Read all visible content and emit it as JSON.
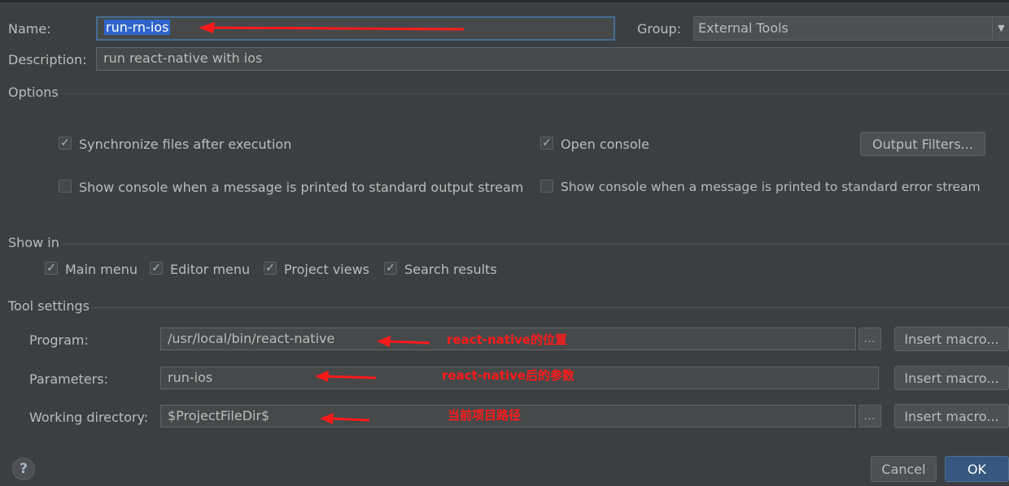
{
  "header": {
    "name_label": "Name:",
    "name_value": "run-rn-ios",
    "group_label": "Group:",
    "group_value": "External Tools",
    "description_label": "Description:",
    "description_value": "run react-native with ios"
  },
  "options": {
    "title": "Options",
    "sync_files": {
      "label": "Synchronize files after execution",
      "checked": true
    },
    "open_console": {
      "label": "Open console",
      "checked": true
    },
    "output_filters_label": "Output Filters...",
    "show_stdout": {
      "label": "Show console when a message is printed to standard output stream",
      "checked": false
    },
    "show_stderr": {
      "label": "Show console when a message is printed to standard error stream",
      "checked": false
    }
  },
  "show_in": {
    "title": "Show in",
    "items": [
      {
        "label": "Main menu",
        "checked": true
      },
      {
        "label": "Editor menu",
        "checked": true
      },
      {
        "label": "Project views",
        "checked": true
      },
      {
        "label": "Search results",
        "checked": true
      }
    ]
  },
  "tool_settings": {
    "title": "Tool settings",
    "program_label": "Program:",
    "program_value": "/usr/local/bin/react-native",
    "parameters_label": "Parameters:",
    "parameters_value": "run-ios",
    "workdir_label": "Working directory:",
    "workdir_value": "$ProjectFileDir$",
    "insert_macro_label": "Insert macro...",
    "browse_label": "..."
  },
  "annotations": {
    "program_note": "react-native的位置",
    "parameters_note": "react-native后的参数",
    "workdir_note": "当前项目路径"
  },
  "footer": {
    "help_label": "?",
    "cancel_label": "Cancel",
    "ok_label": "OK"
  },
  "colors": {
    "background": "#3c3f41",
    "field_bg": "#45494a",
    "focus_border": "#466d94",
    "selection": "#2f65ca",
    "annotation_red": "#ff1a1a",
    "ok_button": "#365880"
  },
  "icons": {
    "check": "check-icon",
    "dropdown": "chevron-down-icon",
    "help": "help-icon",
    "arrow": "red-arrow-annotation"
  }
}
